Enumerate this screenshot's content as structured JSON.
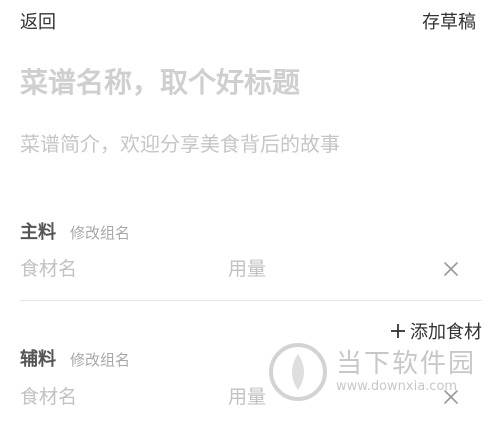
{
  "header": {
    "back_label": "返回",
    "draft_label": "存草稿"
  },
  "recipe": {
    "title_placeholder": "菜谱名称，取个好标题",
    "intro_placeholder": "菜谱简介，欢迎分享美食背后的故事"
  },
  "groups": [
    {
      "title": "主料",
      "rename_label": "修改组名",
      "ingredient": {
        "name_placeholder": "食材名",
        "qty_placeholder": "用量"
      }
    },
    {
      "title": "辅料",
      "rename_label": "修改组名",
      "ingredient": {
        "name_placeholder": "食材名",
        "qty_placeholder": "用量"
      }
    }
  ],
  "add_ingredient_label": "添加食材",
  "watermark": {
    "name": "当下软件园",
    "url": "www.downxia.com"
  },
  "colors": {
    "placeholder": "#c6c6c6",
    "text": "#333333",
    "divider": "#e6e6e6"
  }
}
